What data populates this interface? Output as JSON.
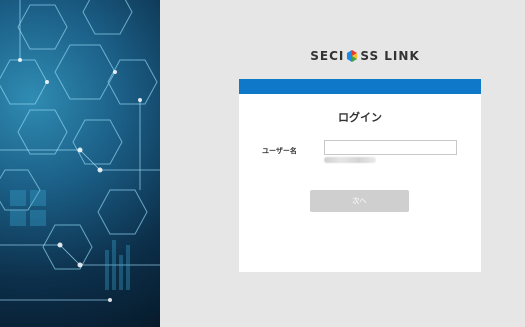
{
  "brand": {
    "logo_text_left": "SECI",
    "logo_text_right": "SS LINK",
    "accent_color": "#0f78c8",
    "logo_mark_colors": [
      "#e53935",
      "#fbc02d",
      "#43a047",
      "#1e88e5"
    ]
  },
  "login": {
    "title": "ログイン",
    "username_label": "ユーザー名",
    "username_value": "",
    "username_placeholder": "",
    "next_label": "次へ"
  },
  "colors": {
    "header_bar": "#0f78c8",
    "button_disabled": "#cfcfcf",
    "background": "#e6e6e6"
  }
}
